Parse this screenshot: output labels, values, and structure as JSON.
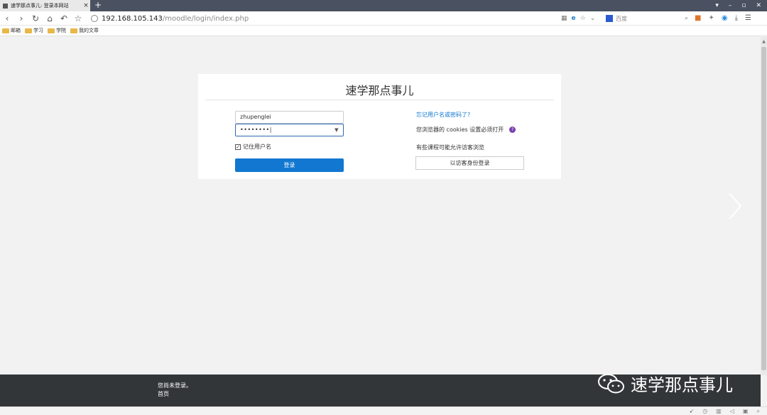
{
  "browser": {
    "tab_title": "速学那点事儿: 登录本网站",
    "tab_close": "×",
    "new_tab": "+",
    "url_host": "192.168.105.143",
    "url_path": "/moodle/login/index.php",
    "search_engine_label": "百度",
    "window_controls": [
      "▾",
      "–",
      "▫",
      "✕"
    ],
    "nav": {
      "back": "‹",
      "forward": "›",
      "reload": "↻",
      "home": "⌂",
      "undo": "↶",
      "favorite": "☆"
    }
  },
  "bookmarks": [
    {
      "label": "邮箱"
    },
    {
      "label": "学习"
    },
    {
      "label": "学院"
    },
    {
      "label": "我的文章"
    }
  ],
  "login": {
    "site_title": "速学那点事儿",
    "username_value": "zhupenglei",
    "password_value": "••••••••|",
    "remember_label": "记住用户名",
    "remember_checked": "✓",
    "login_button": "登录",
    "forgot_link": "忘记用户名或密码了?",
    "cookies_note": "您浏览器的 cookies 设置必须打开",
    "help_symbol": "?",
    "guest_note": "有些课程可能允许访客浏览",
    "guest_button": "以访客身份登录"
  },
  "footer": {
    "status": "您尚未登录。",
    "home_link": "首页"
  },
  "watermark": {
    "text": "速学那点事儿"
  },
  "colors": {
    "primary": "#1177d1",
    "footer_bg": "#333638",
    "help_icon": "#7a3fb0",
    "page_bg": "#f2f2f2"
  }
}
